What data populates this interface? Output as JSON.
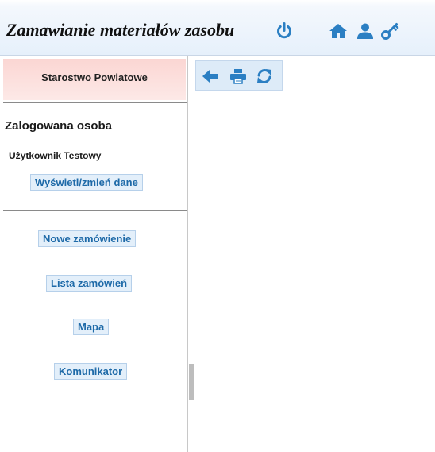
{
  "header": {
    "title": "Zamawianie materiałów zasobu",
    "icons": [
      "power-icon",
      "home-icon",
      "user-icon",
      "key-icon"
    ]
  },
  "sidebar": {
    "organization": "Starostwo Powiatowe",
    "logged_section_title": "Zalogowana osoba",
    "user_name": "Użytkownik Testowy",
    "edit_data_label": "Wyświetl/zmień dane",
    "menu": [
      {
        "label": "Nowe zamówienie"
      },
      {
        "label": "Lista zamówień"
      },
      {
        "label": "Mapa"
      },
      {
        "label": "Komunikator"
      }
    ]
  },
  "content": {
    "toolbar_icons": [
      "arrow-left-icon",
      "print-icon",
      "refresh-icon"
    ]
  },
  "colors": {
    "icon_blue": "#2b7fc3",
    "link_text": "#1e6aa8",
    "link_bg": "#e3effa",
    "org_bg": "#fbd6d3"
  }
}
